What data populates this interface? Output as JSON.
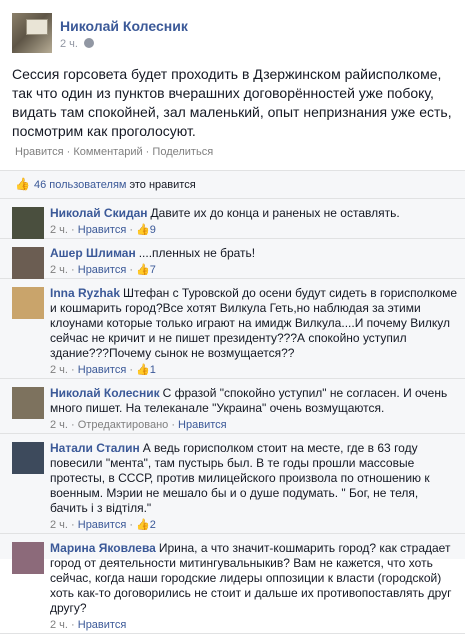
{
  "post": {
    "author": "Николай Колесник",
    "time": "2 ч.",
    "text": "Сессия горсовета будет проходить в Дзержинском райисполкоме, так что один из пунктов вчерашних договорённостей уже побоку, видать там спокойней, зал маленький, опыт непризнания уже есть, посмотрим как проголосуют.",
    "actions": {
      "like": "Нравится",
      "comment": "Комментарий",
      "share": "Поделиться",
      "sep": " · "
    },
    "likes_text": "46 пользователям",
    "likes_suffix": " это нравится"
  },
  "comments": [
    {
      "name": "Николай Скидан",
      "text": "Давите их до конца и раненых не оставлять.",
      "time": "2 ч.",
      "like_label": "Нравится",
      "likes": "9",
      "avatar_color": "#4a4f3e"
    },
    {
      "name": "Ашер Шлиман",
      "text": "....пленных не брать!",
      "time": "2 ч.",
      "like_label": "Нравится",
      "likes": "7",
      "avatar_color": "#6b5d52"
    },
    {
      "name": "Inna Ryzhak",
      "text": "Штефан с Туровской до осени будут сидеть в горисполкоме и кошмарить город?Все хотят Вилкула Геть,но наблюдая за этими клоунами которые только играют на имидж Вилкула....И почему Вилкул сейчас не кричит и не пишет президенту???А спокойно уступил здание???Почему сынок не возмущается??",
      "time": "2 ч.",
      "like_label": "Нравится",
      "likes": "1",
      "avatar_color": "#c9a46b"
    },
    {
      "name": "Николай Колесник",
      "text": "С фразой \"спокойно уступил\" не согласен. И очень много пишет. На телеканале \"Украина\" очень возмущаются.",
      "time": "2 ч.",
      "edited": "Отредактировано",
      "like_label": "Нравится",
      "avatar_color": "#7d725e"
    },
    {
      "name": "Натали Сталин",
      "text": "А ведь горисполком стоит на месте, где в 63 году повесили \"мента\", там пустырь был. В те годы прошли массовые протесты, в СССР, против милицейского произвола по отношению к военным. Мэрии не мешало бы и о душе подумать. \" Бог, не теля, бачить і з відтіля.\"",
      "time": "2 ч.",
      "like_label": "Нравится",
      "likes": "2",
      "avatar_color": "#3d4a5c"
    },
    {
      "name": "Марина Яковлева",
      "text": "Ирина, а что значит-кошмарить город? как страдает город от деятельности митингувальныкив? Вам не кажется, что хоть сейчас, когда наши городские лидеры оппозиции к власти (городской) хоть как-то договорились не стоит и дальше их противопоставлять друг другу?",
      "time": "2 ч.",
      "like_label": "Нравится",
      "avatar_color": "#8c6a7a"
    }
  ]
}
